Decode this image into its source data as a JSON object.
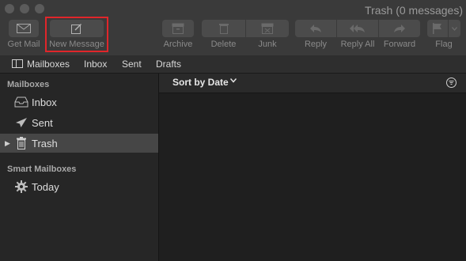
{
  "window": {
    "title": "Trash (0 messages)"
  },
  "toolbar": {
    "get_mail": "Get Mail",
    "new_message": "New Message",
    "archive": "Archive",
    "delete": "Delete",
    "junk": "Junk",
    "reply": "Reply",
    "reply_all": "Reply All",
    "forward": "Forward",
    "flag": "Flag"
  },
  "favorites_bar": {
    "mailboxes": "Mailboxes",
    "inbox": "Inbox",
    "sent": "Sent",
    "drafts": "Drafts"
  },
  "sidebar": {
    "mailboxes_header": "Mailboxes",
    "items": [
      {
        "label": "Inbox",
        "icon": "inbox-icon"
      },
      {
        "label": "Sent",
        "icon": "paper-plane-icon"
      },
      {
        "label": "Trash",
        "icon": "trash-icon",
        "selected": true
      }
    ],
    "smart_header": "Smart Mailboxes",
    "smart_items": [
      {
        "label": "Today",
        "icon": "gear-icon"
      }
    ]
  },
  "message_list": {
    "sort_label": "Sort by Date"
  },
  "colors": {
    "highlight": "#e0262a",
    "selected_row": "#464646"
  }
}
